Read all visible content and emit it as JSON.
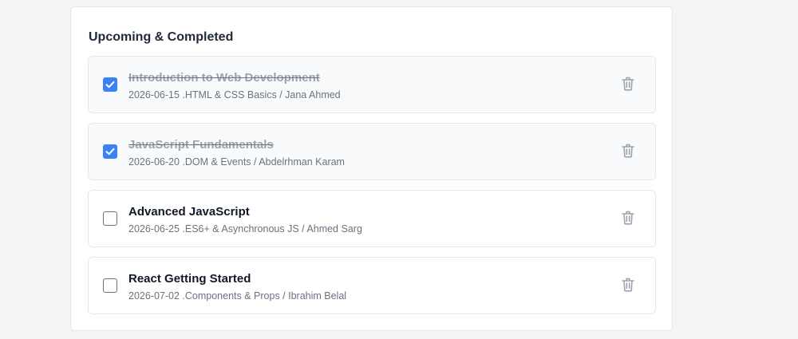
{
  "section": {
    "title": "Upcoming & Completed"
  },
  "courses": [
    {
      "title": "Introduction to Web Development",
      "meta": "2026-06-15 .HTML & CSS Basics / Jana Ahmed",
      "completed": true
    },
    {
      "title": "JavaScript Fundamentals",
      "meta": "2026-06-20 .DOM & Events / Abdelrhman Karam",
      "completed": true
    },
    {
      "title": "Advanced JavaScript",
      "meta": "2026-06-25 .ES6+ & Asynchronous JS / Ahmed Sarg",
      "completed": false
    },
    {
      "title": "React Getting Started",
      "meta": "2026-07-02 .Components & Props / Ibrahim Belal",
      "completed": false
    }
  ],
  "colors": {
    "checkbox_checked": "#3b82f6",
    "trash_icon": "#9ca3af"
  },
  "icons": {
    "checkbox": "checkbox-icon",
    "delete": "trash-icon"
  }
}
